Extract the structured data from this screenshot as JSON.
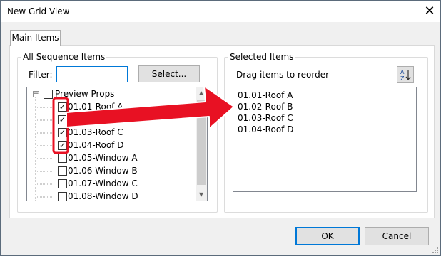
{
  "window": {
    "title": "New Grid View",
    "close_icon": "close-icon"
  },
  "tabs": [
    {
      "label": "Main Items",
      "selected": true
    }
  ],
  "left_group": {
    "legend": "All Sequence Items",
    "filter_label": "Filter:",
    "filter_value": "",
    "select_button": "Select...",
    "tree": {
      "root": {
        "label": "Preview Props",
        "expanded": true,
        "checked": false
      },
      "children": [
        {
          "label": "01.01-Roof A",
          "checked": true
        },
        {
          "label": "01.02-Roof B",
          "checked": true
        },
        {
          "label": "01.03-Roof C",
          "checked": true
        },
        {
          "label": "01.04-Roof D",
          "checked": true
        },
        {
          "label": "01.05-Window A",
          "checked": false
        },
        {
          "label": "01.06-Window B",
          "checked": false
        },
        {
          "label": "01.07-Window C",
          "checked": false
        },
        {
          "label": "01.08-Window D",
          "checked": false
        }
      ]
    }
  },
  "right_group": {
    "legend": "Selected Items",
    "drag_label": "Drag items to reorder",
    "sort_icon": "sort-az-icon",
    "items": [
      "01.01-Roof A",
      "01.02-Roof B",
      "01.03-Roof C",
      "01.04-Roof D"
    ]
  },
  "footer": {
    "ok_label": "OK",
    "cancel_label": "Cancel"
  },
  "colors": {
    "accent": "#0078d7",
    "annotation": "#e81123",
    "dialog_bg": "#f0f0f0"
  }
}
